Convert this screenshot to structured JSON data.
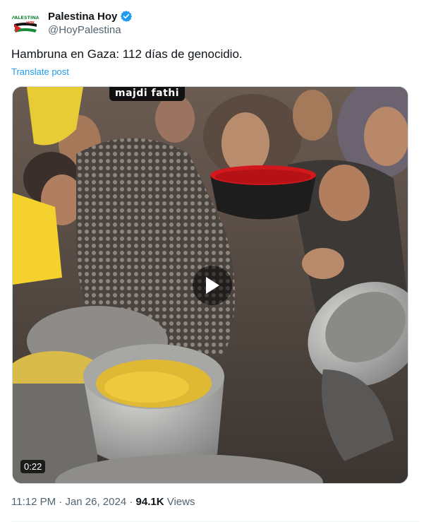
{
  "author": {
    "display_name": "Palestina Hoy",
    "handle": "@HoyPalestina",
    "avatar_text_top": "PALESTINA",
    "avatar_text_bottom": "HOY",
    "verified_color": "#1d9bf0"
  },
  "tweet": {
    "text": "Hambruna en Gaza: 112 días de genocidio.",
    "translate_label": "Translate post"
  },
  "media": {
    "watermark": "majdi fathi",
    "duration": "0:22",
    "play_icon": "play-icon"
  },
  "meta": {
    "time": "11:12 PM",
    "separator": "·",
    "date": "Jan 26, 2024",
    "views_count": "94.1K",
    "views_label": "Views"
  },
  "colors": {
    "link": "#1d9bf0",
    "secondary_text": "#536471",
    "primary_text": "#0f1419"
  }
}
